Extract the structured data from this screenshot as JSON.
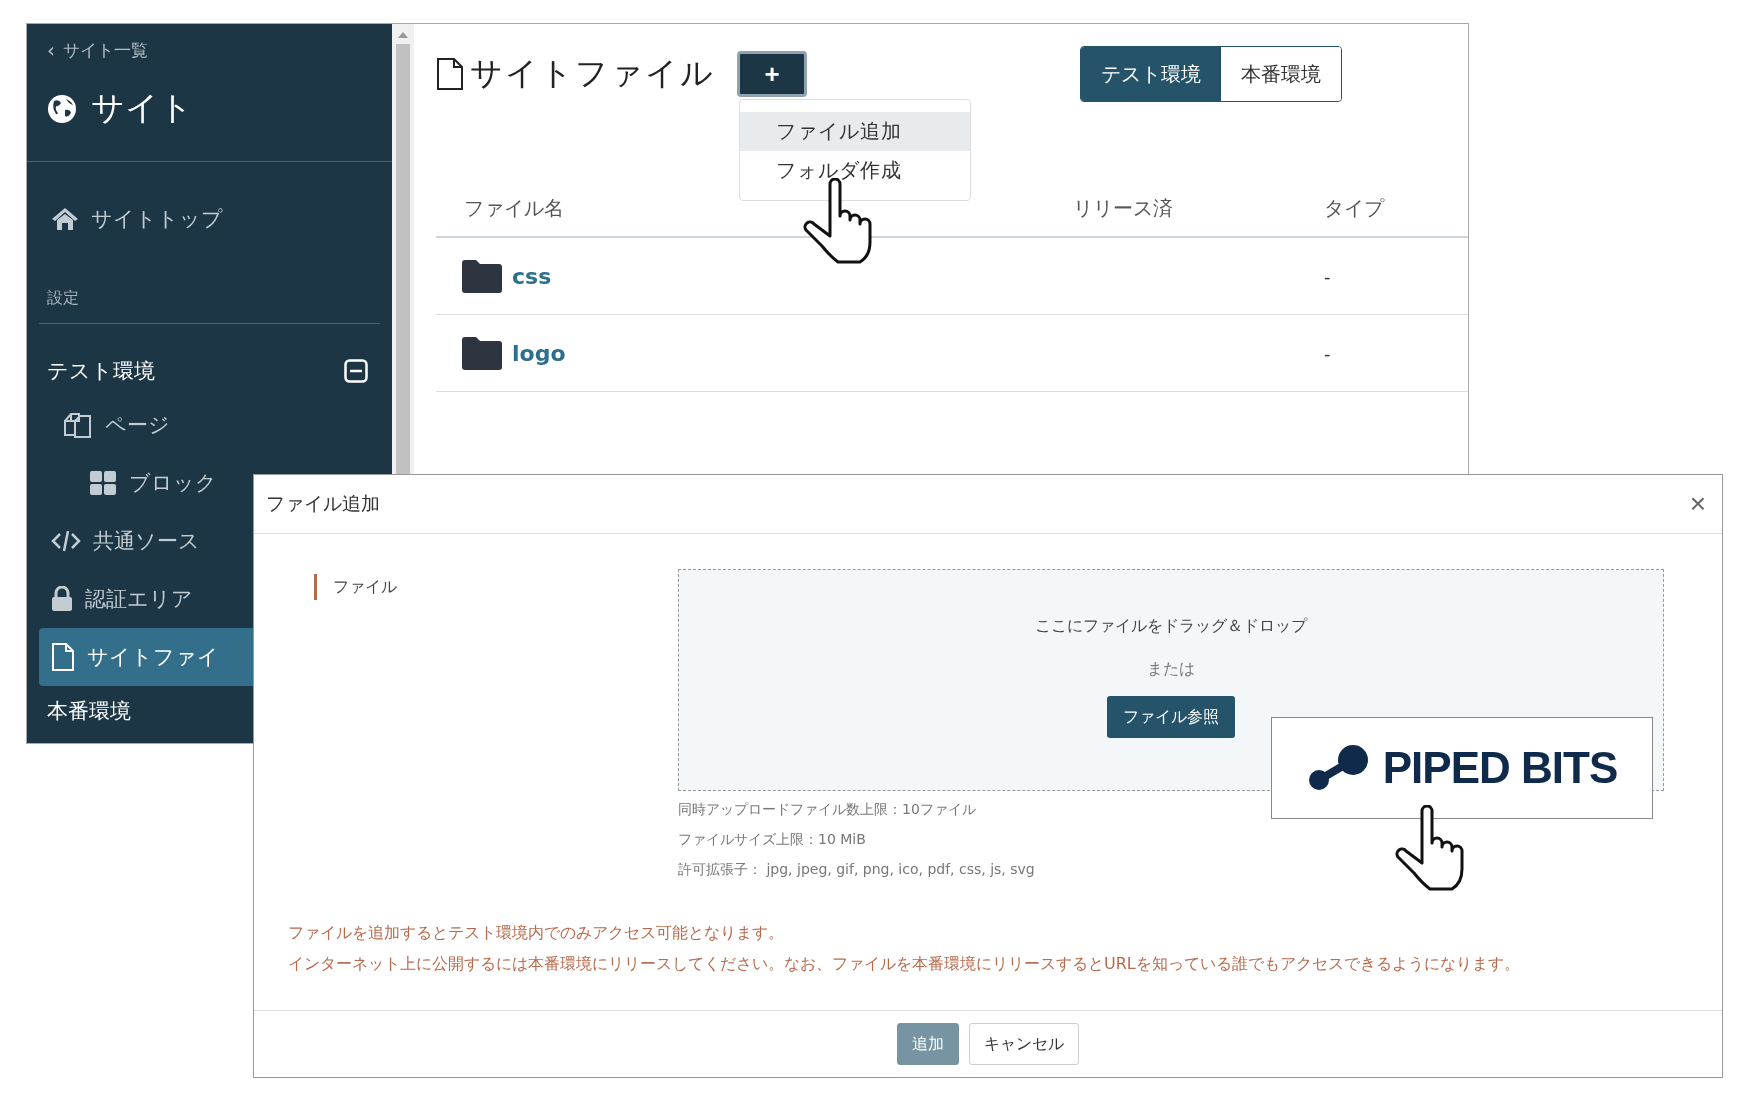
{
  "back_window": {
    "sidebar": {
      "back_link": {
        "chevron": "‹",
        "label": "サイト一覧"
      },
      "title": "サイト",
      "top_item": {
        "label": "サイトトップ",
        "selected": false
      },
      "section_label": "設定",
      "groups": [
        {
          "label": "テスト環境",
          "expanded": true,
          "items": [
            {
              "label": "ページ",
              "selected": false,
              "children": [
                {
                  "label": "ブロック",
                  "selected": false
                }
              ]
            },
            {
              "label": "共通ソース",
              "selected": false
            },
            {
              "label": "認証エリア",
              "selected": false
            },
            {
              "label": "サイトファイ",
              "selected": true
            }
          ]
        },
        {
          "label": "本番環境"
        }
      ]
    },
    "main": {
      "title": "サイトファイル",
      "add_button": "+",
      "menu": [
        {
          "label": "ファイル追加",
          "selected": true
        },
        {
          "label": "フォルダ作成",
          "selected": false
        }
      ],
      "env_tabs": [
        {
          "label": "テスト環境",
          "selected": true
        },
        {
          "label": "本番環境",
          "selected": false
        }
      ],
      "table": {
        "columns": [
          "ファイル名",
          "リリース済",
          "タイプ"
        ],
        "rows": [
          {
            "kind": "folder",
            "name": "css",
            "type": "-"
          },
          {
            "kind": "folder",
            "name": "logo",
            "type": "-"
          }
        ]
      }
    }
  },
  "dialog": {
    "title": "ファイル追加",
    "close": "×",
    "field_label": "ファイル",
    "dropzone": {
      "prompt": "ここにファイルをドラッグ＆ドロップ",
      "or": "または",
      "browse_button": "ファイル参照"
    },
    "limits": [
      "同時アップロードファイル数上限：10ファイル",
      "ファイルサイズ上限：10 MiB",
      "許可拡張子： jpg, jpeg, gif, png, ico, pdf, css, js, svg"
    ],
    "notes": [
      "ファイルを追加するとテスト環境内でのみアクセス可能となります。",
      "インターネット上に公開するには本番環境にリリースしてください。なお、ファイルを本番環境にリリースするとURLを知っている誰でもアクセスできるようになります。"
    ],
    "buttons": [
      {
        "label": "追加",
        "kind": "primary",
        "disabled": true
      },
      {
        "label": "キャンセル",
        "kind": "secondary",
        "disabled": false
      }
    ]
  },
  "logo_overlay": {
    "text": "PIPED BITS"
  }
}
